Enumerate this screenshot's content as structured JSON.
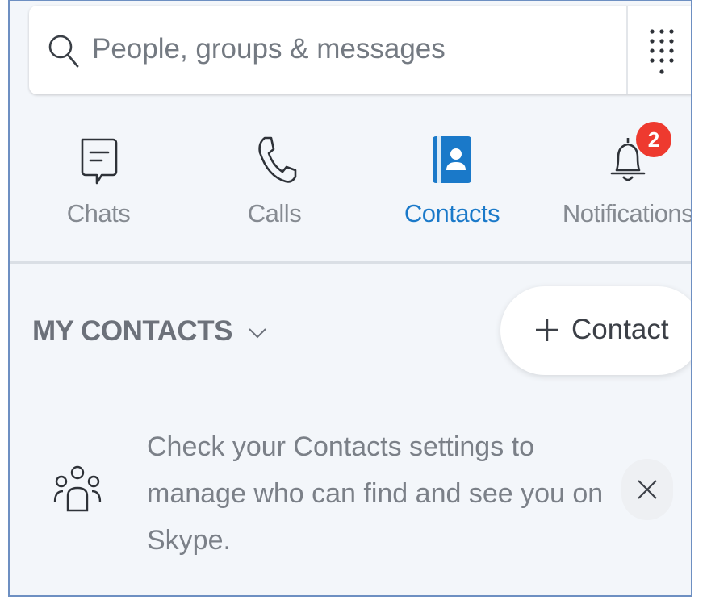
{
  "search": {
    "placeholder": "People, groups & messages",
    "icon": "search-icon",
    "dialpad_icon": "dialpad-icon"
  },
  "tabs": [
    {
      "label": "Chats",
      "icon": "chat-icon",
      "active": false
    },
    {
      "label": "Calls",
      "icon": "phone-icon",
      "active": false
    },
    {
      "label": "Contacts",
      "icon": "contacts-book-icon",
      "active": true
    },
    {
      "label": "Notifications",
      "icon": "bell-icon",
      "active": false,
      "badge": "2"
    }
  ],
  "contacts": {
    "section_title": "MY CONTACTS",
    "add_button_label": "Contact"
  },
  "notice": {
    "text": "Check your Contacts settings to manage who can find and see you on Skype.",
    "icon": "people-group-icon",
    "close_icon": "close-icon"
  },
  "colors": {
    "accent": "#1a79c9",
    "badge": "#ee3a2f",
    "background": "#f3f6fa",
    "frame_border": "#6d8fc2"
  }
}
